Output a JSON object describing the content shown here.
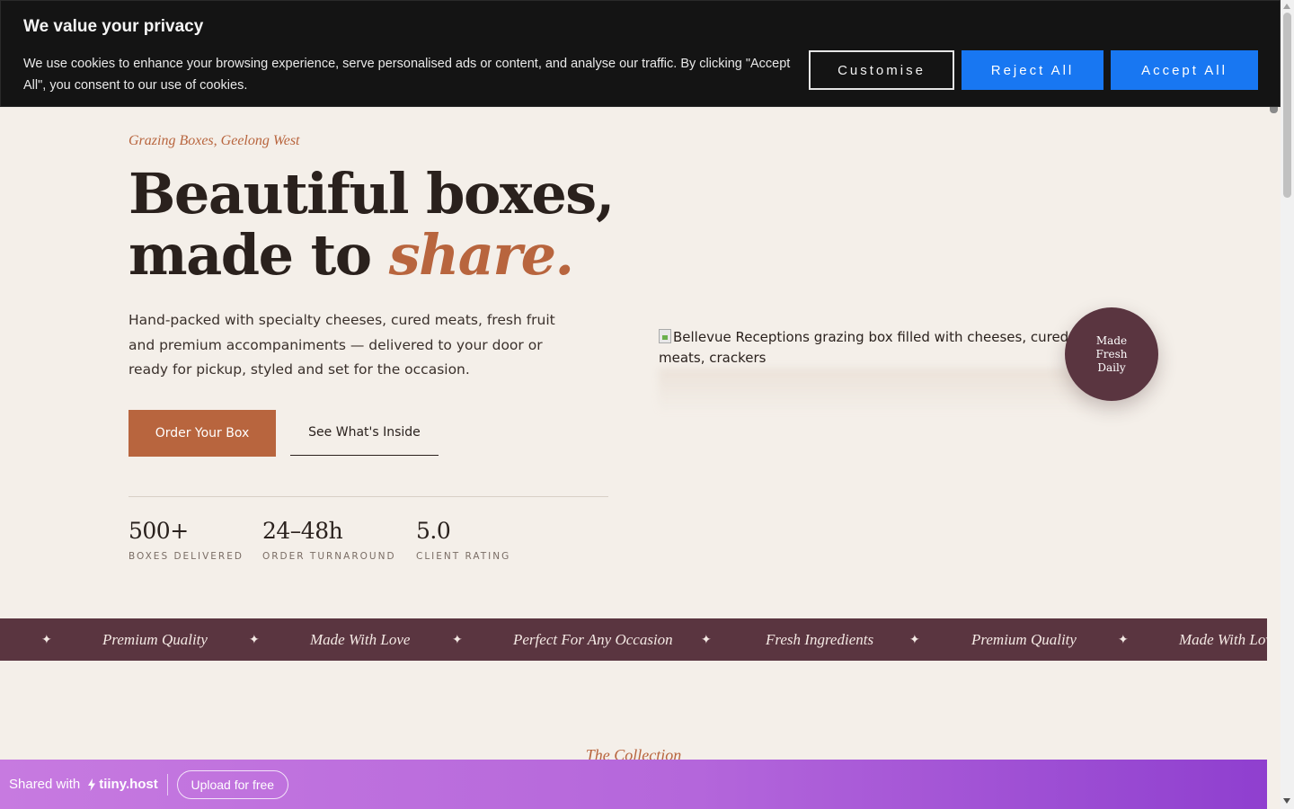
{
  "cookie": {
    "title": "We value your privacy",
    "text": "We use cookies to enhance your browsing experience, serve personalised ads or content, and analyse our traffic. By clicking \"Accept All\", you consent to our use of cookies.",
    "customise_label": "Customise",
    "reject_label": "Reject All",
    "accept_label": "Accept All",
    "accent_color": "#1877f2"
  },
  "hero": {
    "eyebrow": "Grazing Boxes, Geelong West",
    "headline_line1": "Beautiful boxes,",
    "headline_line2_start": "made to",
    "headline_accent": "share.",
    "lead": "Hand-packed with specialty cheeses, cured meats, fresh fruit and premium accompaniments — delivered to your door or ready for pickup, styled and set for the occasion.",
    "primary_cta": "Order Your Box",
    "secondary_cta": "See What's Inside",
    "image_alt": "Bellevue Receptions grazing box filled with cheeses, cured meats, crackers",
    "badge": "Made Fresh Daily",
    "stats": [
      {
        "value": "500+",
        "label": "BOXES DELIVERED"
      },
      {
        "value": "24–48h",
        "label": "ORDER TURNAROUND"
      },
      {
        "value": "5.0",
        "label": "CLIENT RATING"
      }
    ],
    "brand_color": "#b8653e",
    "badge_color": "#5a3540"
  },
  "marquee": {
    "items": [
      "Premium Quality",
      "Made With Love",
      "Perfect For Any Occasion",
      "Fresh Ingredients",
      "Premium Quality",
      "Made With Love"
    ],
    "star_icon": "sparkle-icon",
    "star_glyph": "✦"
  },
  "collection": {
    "eyebrow": "The Collection"
  },
  "tinyhost": {
    "shared_with": "Shared with",
    "logo_text": "tiiny.host",
    "upload_label": "Upload for free"
  }
}
